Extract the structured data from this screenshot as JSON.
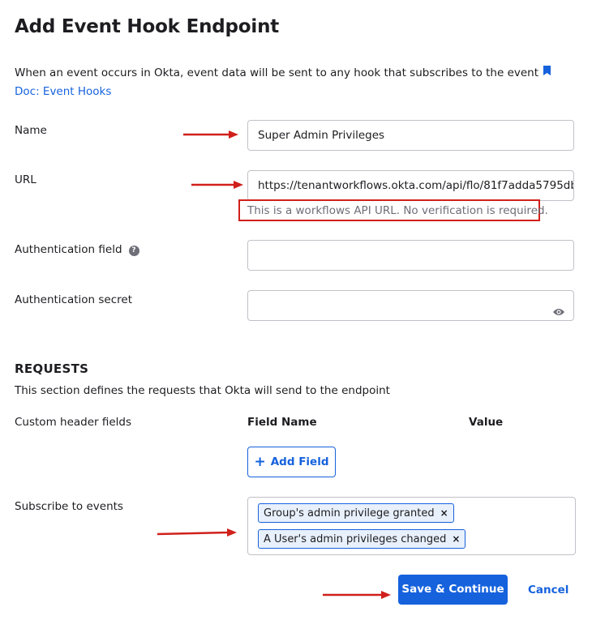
{
  "page": {
    "title": "Add Event Hook Endpoint",
    "intro_text": "When an event occurs in Okta, event data will be sent to any hook that subscribes to the event",
    "doc_link": "Doc: Event Hooks"
  },
  "form": {
    "name_label": "Name",
    "name_value": "Super Admin Privileges",
    "url_label": "URL",
    "url_value": "https://tenantworkflows.okta.com/api/flo/81f7adda5795db",
    "url_hint": "This is a workflows API URL. No verification is required.",
    "auth_field_label": "Authentication field",
    "auth_field_help": "?",
    "auth_field_value": "",
    "auth_secret_label": "Authentication secret",
    "auth_secret_value": ""
  },
  "requests": {
    "heading": "REQUESTS",
    "description": "This section defines the requests that Okta will send to the endpoint",
    "custom_headers_label": "Custom header fields",
    "col_field_name": "Field Name",
    "col_value": "Value",
    "add_field_label": "Add Field",
    "subscribe_label": "Subscribe to events",
    "events": [
      {
        "label": "Group's admin privilege granted",
        "remove": "×"
      },
      {
        "label": "A User's admin privileges changed",
        "remove": "×"
      }
    ]
  },
  "actions": {
    "save_label": "Save & Continue",
    "cancel_label": "Cancel"
  },
  "colors": {
    "accent": "#1662dd",
    "annotation_red": "#d0201b"
  },
  "icons": [
    "doc-icon",
    "help-icon",
    "eye-icon",
    "plus-icon",
    "close-icon",
    "annotation-arrow"
  ]
}
